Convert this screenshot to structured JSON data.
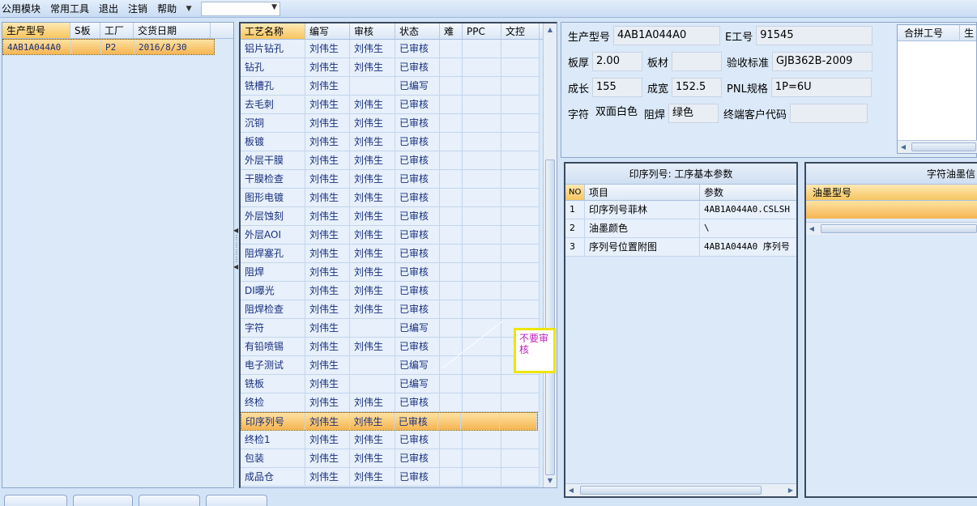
{
  "menubar": {
    "items": [
      "公用模块",
      "常用工具",
      "退出",
      "注销",
      "帮助"
    ],
    "combo_value": ""
  },
  "left_grid": {
    "headers": [
      "生产型号",
      "S板",
      "工厂",
      "交货日期"
    ],
    "rows": [
      {
        "model": "4AB1A044A0",
        "s_board": "",
        "factory": "P2",
        "date": "2016/8/30"
      }
    ]
  },
  "process_grid": {
    "headers": [
      "工艺名称",
      "编写",
      "审核",
      "状态",
      "难",
      "PPC",
      "文控"
    ],
    "rows": [
      {
        "name": "铝片钻孔",
        "writer": "刘伟生",
        "reviewer": "刘伟生",
        "status": "已审核"
      },
      {
        "name": "钻孔",
        "writer": "刘伟生",
        "reviewer": "刘伟生",
        "status": "已审核"
      },
      {
        "name": "铣槽孔",
        "writer": "刘伟生",
        "reviewer": "",
        "status": "已编写"
      },
      {
        "name": "去毛刺",
        "writer": "刘伟生",
        "reviewer": "刘伟生",
        "status": "已审核"
      },
      {
        "name": "沉铜",
        "writer": "刘伟生",
        "reviewer": "刘伟生",
        "status": "已审核"
      },
      {
        "name": "板镀",
        "writer": "刘伟生",
        "reviewer": "刘伟生",
        "status": "已审核"
      },
      {
        "name": "外层干膜",
        "writer": "刘伟生",
        "reviewer": "刘伟生",
        "status": "已审核"
      },
      {
        "name": "干膜检查",
        "writer": "刘伟生",
        "reviewer": "刘伟生",
        "status": "已审核"
      },
      {
        "name": "图形电镀",
        "writer": "刘伟生",
        "reviewer": "刘伟生",
        "status": "已审核"
      },
      {
        "name": "外层蚀刻",
        "writer": "刘伟生",
        "reviewer": "刘伟生",
        "status": "已审核"
      },
      {
        "name": "外层AOI",
        "writer": "刘伟生",
        "reviewer": "刘伟生",
        "status": "已审核"
      },
      {
        "name": "阻焊塞孔",
        "writer": "刘伟生",
        "reviewer": "刘伟生",
        "status": "已审核"
      },
      {
        "name": "阻焊",
        "writer": "刘伟生",
        "reviewer": "刘伟生",
        "status": "已审核"
      },
      {
        "name": "DI曝光",
        "writer": "刘伟生",
        "reviewer": "刘伟生",
        "status": "已审核"
      },
      {
        "name": "阻焊检查",
        "writer": "刘伟生",
        "reviewer": "刘伟生",
        "status": "已审核"
      },
      {
        "name": "字符",
        "writer": "刘伟生",
        "reviewer": "",
        "status": "已编写"
      },
      {
        "name": "有铅喷锡",
        "writer": "刘伟生",
        "reviewer": "刘伟生",
        "status": "已审核"
      },
      {
        "name": "电子测试",
        "writer": "刘伟生",
        "reviewer": "",
        "status": "已编写"
      },
      {
        "name": "铣板",
        "writer": "刘伟生",
        "reviewer": "",
        "status": "已编写"
      },
      {
        "name": "终检",
        "writer": "刘伟生",
        "reviewer": "刘伟生",
        "status": "已审核"
      },
      {
        "name": "印序列号",
        "writer": "刘伟生",
        "reviewer": "刘伟生",
        "status": "已审核",
        "selected": true
      },
      {
        "name": "终检1",
        "writer": "刘伟生",
        "reviewer": "刘伟生",
        "status": "已审核"
      },
      {
        "name": "包装",
        "writer": "刘伟生",
        "reviewer": "刘伟生",
        "status": "已审核"
      },
      {
        "name": "成品仓",
        "writer": "刘伟生",
        "reviewer": "刘伟生",
        "status": "已审核"
      }
    ]
  },
  "note": {
    "text": "不要审核"
  },
  "info": {
    "model_label": "生产型号",
    "model_value": "4AB1A044A0",
    "e_label": "E工号",
    "e_value": "91545",
    "thickness_label": "板厚",
    "thickness_value": "2.00",
    "material_label": "板材",
    "material_value": "",
    "standard_label": "验收标准",
    "standard_value": "GJB362B-2009",
    "length_label": "成长",
    "length_value": "155",
    "width_label": "成宽",
    "width_value": "152.5",
    "pnl_label": "PNL规格",
    "pnl_value": "1P=6U",
    "char_label": "字符",
    "char_value": "双面白色",
    "mask_label": "阻焊",
    "mask_value": "绿色",
    "customer_label": "终端客户代码",
    "customer_value": ""
  },
  "merge_panel": {
    "headers": [
      "合拼工号",
      "生"
    ]
  },
  "params_panel": {
    "title": "印序列号: 工序基本参数",
    "headers": [
      "NO",
      "项目",
      "参数"
    ],
    "rows": [
      {
        "no": "1",
        "item": "印序列号菲林",
        "param": "4AB1A044A0.CSLSH"
      },
      {
        "no": "2",
        "item": "油墨颜色",
        "param": "\\"
      },
      {
        "no": "3",
        "item": "序列号位置附图",
        "param": "4AB1A044A0 序列号"
      }
    ]
  },
  "ink_panel": {
    "title": "字符油墨信",
    "headers": [
      "油墨型号"
    ]
  },
  "colors": {
    "accent": "#f7c55f",
    "text_blue": "#1a2f7d",
    "note_border": "#f0e400",
    "note_text": "#c020c0"
  }
}
